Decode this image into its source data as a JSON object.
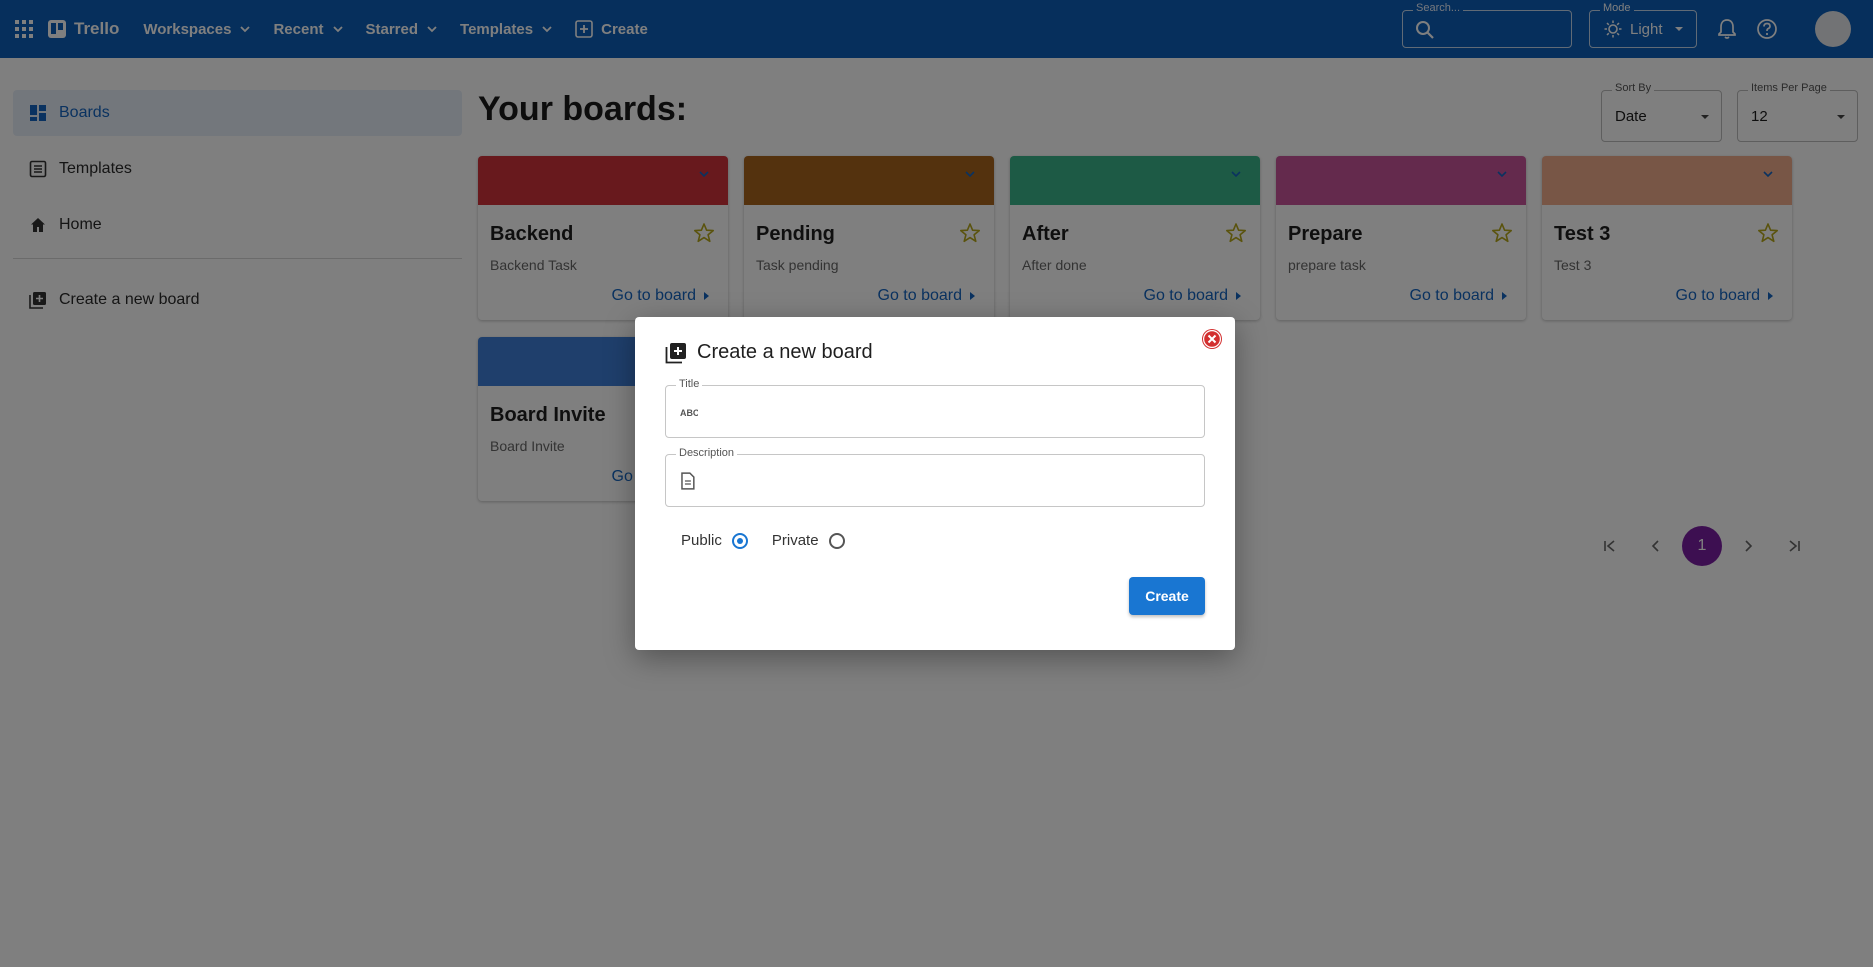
{
  "header": {
    "brand": "Trello",
    "nav": [
      {
        "label": "Workspaces"
      },
      {
        "label": "Recent"
      },
      {
        "label": "Starred"
      },
      {
        "label": "Templates"
      }
    ],
    "create_label": "Create",
    "search_label": "Search...",
    "mode_label": "Mode",
    "mode_value": "Light"
  },
  "sidebar": {
    "items": [
      {
        "label": "Boards",
        "icon": "dashboard-icon",
        "active": true
      },
      {
        "label": "Templates",
        "icon": "list-icon"
      },
      {
        "label": "Home",
        "icon": "home-icon"
      },
      {
        "label": "Create a new board",
        "icon": "library-add-icon"
      }
    ]
  },
  "main": {
    "heading": "Your boards:",
    "sort_by": {
      "label": "Sort By",
      "value": "Date"
    },
    "items_per_page": {
      "label": "Items Per Page",
      "value": "12"
    },
    "goto_label": "Go to board",
    "boards": [
      {
        "title": "Backend",
        "description": "Backend Task",
        "color": "#d1323a"
      },
      {
        "title": "Pending",
        "description": "Task pending",
        "color": "#a8651c"
      },
      {
        "title": "After",
        "description": "After done",
        "color": "#3bb48a"
      },
      {
        "title": "Prepare",
        "description": "prepare task",
        "color": "#c9559a"
      },
      {
        "title": "Test 3",
        "description": "Test 3",
        "color": "#f0ac8d"
      },
      {
        "title": "Board Invite",
        "description": "Board Invite",
        "color": "#3e7fd8"
      }
    ],
    "pagination": {
      "current": "1"
    }
  },
  "dialog": {
    "title": "Create a new board",
    "title_field": {
      "label": "Title",
      "value": ""
    },
    "description_field": {
      "label": "Description",
      "value": ""
    },
    "visibility": {
      "public_label": "Public",
      "private_label": "Private",
      "selected": "Public"
    },
    "submit_label": "Create"
  },
  "colors": {
    "topbar": "#0d5fb8",
    "primary": "#1976d2",
    "star": "#b5a61a",
    "page_active": "#7b1fa2",
    "close": "#d32f2f"
  }
}
